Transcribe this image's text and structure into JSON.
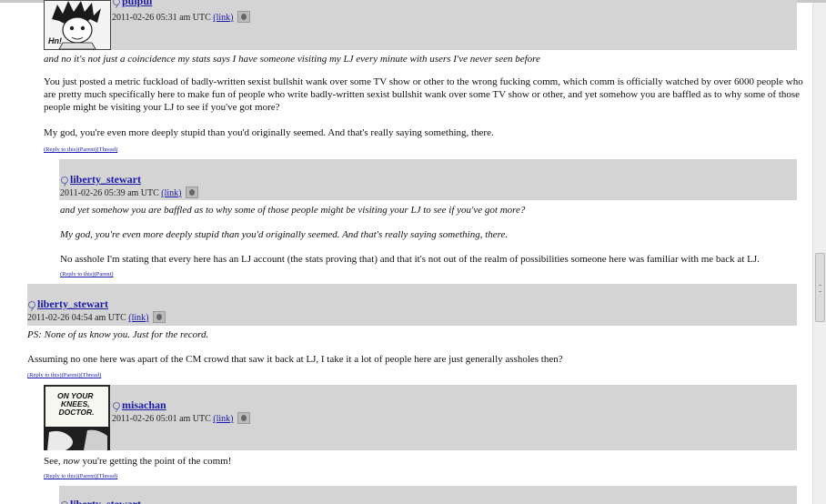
{
  "comments": [
    {
      "username": "pulpul",
      "timestamp": "2011-02-26 05:31 am UTC",
      "link_label": "(link)",
      "avatar_text": "Hn!",
      "quote": "and no it's not just a coincidence my stats says I have someone visiting my LJ every minute with users I've never seen before",
      "paragraphs": [
        "You just posted a metric fuckload of badly-written sexist bullshit wank over some TV show or other to the wrong fucking comm, which comm is officially watched by over 6000 people who are pretty much specifically here to make fun of people who write badly-written sexist bullshit wank over some TV show or other, and yet somehow you are baffled as to why some of those people might be visiting your LJ to see if you've got more?",
        "My god, you're even more deeply stupid than you'd originally seemed. And that's really saying something, there."
      ],
      "actions": [
        "(Reply to this)",
        "(Parent)",
        "(Thread)"
      ]
    },
    {
      "username": "liberty_stewart",
      "timestamp": "2011-02-26 05:39 am UTC",
      "link_label": "(link)",
      "quotes": [
        "and yet somehow you are baffled as to why some of those people might be visiting your LJ to see if you've got more?",
        "My god, you're even more deeply stupid than you'd originally seemed. And that's really saying something, there."
      ],
      "body": "No asshole I'm stating that every here has an LJ account (the stats proving that) and that it's not out of the realm of possibilities someone here was familiar with me back at LJ.",
      "actions": [
        "(Reply to this)",
        "(Parent)"
      ]
    },
    {
      "username": "liberty_stewart",
      "timestamp": "2011-02-26 04:54 am UTC",
      "link_label": "(link)",
      "ps": "PS: None of us know you. Just for the record.",
      "body": "Assuming no one here was apart of the CM crowd that saw it back at LJ, I take it a lot of people here are just generally assholes then?",
      "actions": [
        "(Reply to this)",
        "(Parent)",
        "(Thread)"
      ]
    },
    {
      "username": "misachan",
      "timestamp": "2011-02-26 05:01 am UTC",
      "link_label": "(link)",
      "avatar_text": "ON YOUR KNEES, DOCTOR.",
      "body_before": "See, ",
      "body_em": "now",
      "body_after": " you're getting the point of the comm!",
      "actions": [
        "(Reply to this)",
        "(Parent)",
        "(Thread)"
      ]
    },
    {
      "username": "liberty_stewart"
    }
  ]
}
